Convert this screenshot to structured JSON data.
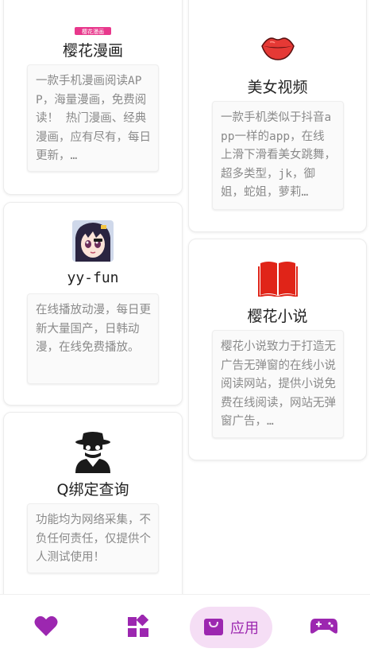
{
  "apps": {
    "left": [
      {
        "icon": "sakura-comic-logo",
        "logo_text": "樱花漫画",
        "title": "樱花漫画",
        "description": "一款手机漫画阅读APP，海量漫画，免费阅读！ 热门漫画、经典漫画，应有尽有，每日更新，…"
      },
      {
        "icon": "anime-girl-avatar",
        "title": "yy-fun",
        "description": "在线播放动漫，每日更新大量国产，日韩动漫，在线免费播放。"
      },
      {
        "icon": "spy-icon",
        "title": "Q绑定查询",
        "description": "功能均为网络采集，不负任何责任，仅提供个人测试使用！"
      }
    ],
    "right": [
      {
        "icon": "lips-icon",
        "title": "美女视频",
        "description": "一款手机类似于抖音app一样的app，在线上滑下滑看美女跳舞，超多类型，jk，御姐，蛇姐，萝莉…"
      },
      {
        "icon": "book-icon",
        "title": "樱花小说",
        "description": "樱花小说致力于打造无广告无弹窗的在线小说阅读网站，提供小说免费在线阅读，网站无弹窗广告，…"
      }
    ]
  },
  "bottom_nav": {
    "items": [
      {
        "icon": "heart-icon",
        "label": ""
      },
      {
        "icon": "widgets-icon",
        "label": ""
      },
      {
        "icon": "shopping-bag-icon",
        "label": "应用",
        "selected": true
      },
      {
        "icon": "gamepad-icon",
        "label": ""
      }
    ],
    "active_color": "#9c27b0",
    "pill_color": "#f5def5"
  }
}
